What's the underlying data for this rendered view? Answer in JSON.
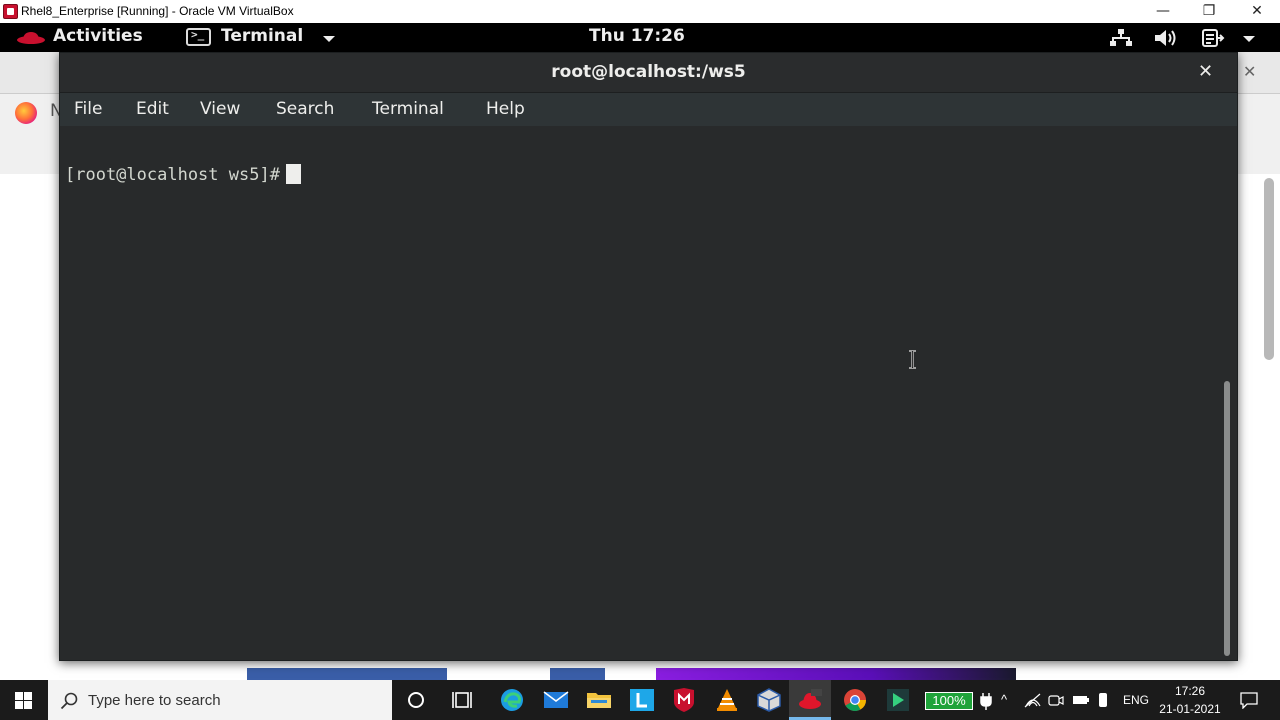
{
  "host_window": {
    "title": "Rhel8_Enterprise [Running] - Oracle VM VirtualBox",
    "minimize_glyph": "—",
    "maximize_glyph": "❐",
    "close_glyph": "✕"
  },
  "gnome_topbar": {
    "activities_label": "Activities",
    "app_menu_label": "Terminal",
    "terminal_icon_glyph": ">_",
    "clock": "Thu 17:26",
    "icons": [
      "redhat-icon",
      "network-icon",
      "volume-icon",
      "power-icon",
      "chevron-down-icon"
    ]
  },
  "firefox_background": {
    "tab_text_fragment": "N",
    "close_glyph": "✕",
    "back_glyph": "←",
    "menu_glyph": "☰"
  },
  "terminal": {
    "title": "root@localhost:/ws5",
    "close_glyph": "✕",
    "menu": [
      "File",
      "Edit",
      "View",
      "Search",
      "Terminal",
      "Help"
    ],
    "prompt": "[root@localhost ws5]#",
    "colors": {
      "background": "#282a2b",
      "foreground": "#d3d7cf",
      "header": "#2a2c2d"
    }
  },
  "taskbar": {
    "search_placeholder": "Type here to search",
    "pinned_icons": [
      "cortana-icon",
      "task-view-icon",
      "edge-icon",
      "mail-icon",
      "file-explorer-icon",
      "l-app-icon",
      "mcafee-icon",
      "vlc-icon",
      "virtualbox-icon",
      "rhel-vm-icon",
      "chrome-icon",
      "green-arrow-app-icon"
    ],
    "battery_percent": "100%",
    "language": "ENG",
    "time": "17:26",
    "date": "21-01-2021",
    "tray_chevron_glyph": "^"
  }
}
